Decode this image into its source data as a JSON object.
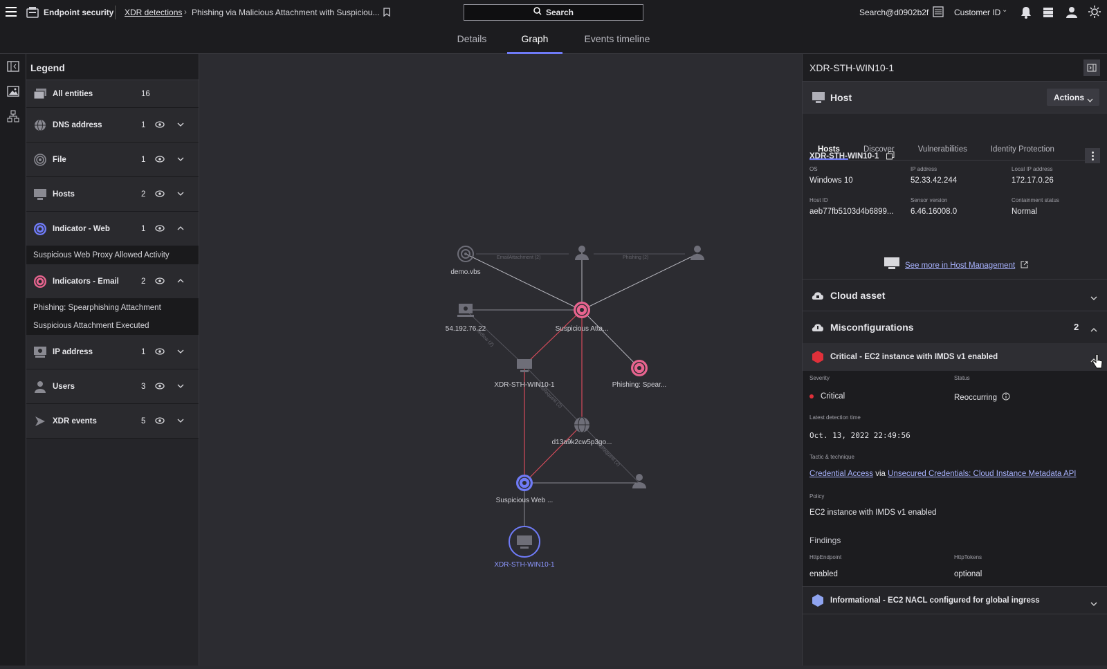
{
  "topbar": {
    "app_name": "Endpoint security",
    "breadcrumb_link": "XDR detections",
    "breadcrumb_current": "Phishing via Malicious Attachment with Suspiciou...",
    "search_label": "Search",
    "user": "Search@d0902b2f",
    "customer_id": "Customer ID"
  },
  "tabs": [
    "Details",
    "Graph",
    "Events timeline"
  ],
  "legend": {
    "title": "Legend",
    "rows": [
      {
        "label": "All entities",
        "count": "16"
      },
      {
        "label": "DNS address",
        "count": "1"
      },
      {
        "label": "File",
        "count": "1"
      },
      {
        "label": "Hosts",
        "count": "2"
      },
      {
        "label": "Indicator - Web",
        "count": "1"
      },
      {
        "label": "Indicators - Email",
        "count": "2"
      },
      {
        "label": "IP address",
        "count": "1"
      },
      {
        "label": "Users",
        "count": "3"
      },
      {
        "label": "XDR events",
        "count": "5"
      }
    ],
    "web_sub": [
      "Suspicious Web Proxy Allowed Activity"
    ],
    "email_sub": [
      "Phishing: Spearphishing Attachment",
      "Suspicious Attachment Executed"
    ]
  },
  "graph": {
    "labels": {
      "demo": "demo.vbs",
      "ip": "54.192.76.22",
      "susp_att": "Suspicious Atta...",
      "host1": "XDR-STH-WIN10-1",
      "phish": "Phishing: Spear...",
      "dns": "d13a9k2cw5p3go...",
      "web": "Suspicious Web ...",
      "host2": "XDR-STH-WIN10-1"
    },
    "edges": {
      "email_attachment": "EmailAttachment (2)",
      "phishing": "Phishing (2)",
      "dns1": "netflow (2)",
      "dns2": "dnsRequest (2)",
      "dns3": "dnsRequest (2)"
    },
    "colors": {
      "email": "#e8648f",
      "web": "#6f7bf7",
      "neutral": "#6e6e78",
      "red_edge": "#d44b5a"
    }
  },
  "panel": {
    "title": "XDR-STH-WIN10-1",
    "host_heading": "Host",
    "actions_label": "Actions",
    "host_name": "XDR-STH-WIN10-1",
    "subtabs": [
      "Hosts",
      "Discover",
      "Vulnerabilities",
      "Identity Protection"
    ],
    "fields": [
      {
        "label": "OS",
        "value": "Windows 10"
      },
      {
        "label": "IP address",
        "value": "52.33.42.244"
      },
      {
        "label": "Local IP address",
        "value": "172.17.0.26"
      },
      {
        "label": "Host ID",
        "value": "aeb77fb5103d4b6899..."
      },
      {
        "label": "Sensor version",
        "value": "6.46.16008.0"
      },
      {
        "label": "Containment status",
        "value": "Normal"
      }
    ],
    "see_more": "See more in Host Management",
    "cloud_asset": "Cloud asset",
    "misconfig": {
      "title": "Misconfigurations",
      "count": "2"
    },
    "critical_item": "Critical - EC2 instance with IMDS v1 enabled",
    "severity_label": "Severity",
    "severity_value": "Critical",
    "status_label": "Status",
    "status_value": "Reoccurring",
    "latest_label": "Latest detection time",
    "latest_value": "Oct. 13, 2022 22:49:56",
    "tactic_label": "Tactic & technique",
    "tactic_link": "Credential Access",
    "tactic_via": "via",
    "technique_link": "Unsecured Credentials: Cloud Instance Metadata API",
    "policy_label": "Policy",
    "policy_value": "EC2 instance with IMDS v1 enabled",
    "findings_label": "Findings",
    "http_endpoint_label": "HttpEndpoint",
    "http_endpoint_value": "enabled",
    "http_tokens_label": "HttpTokens",
    "http_tokens_value": "optional",
    "info_item": "Informational - EC2 NACL configured for global ingress",
    "colors": {
      "critical": "#e0303a",
      "info": "#8fa4f0"
    }
  }
}
